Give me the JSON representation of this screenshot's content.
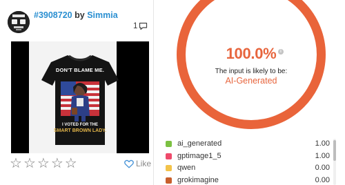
{
  "post": {
    "id_label": "#3908720",
    "by_label": "by",
    "author": "Simmia",
    "comment_count": "1"
  },
  "tshirt": {
    "top_line": "DON'T BLAME ME.",
    "bottom_line1": "I VOTED FOR THE",
    "bottom_line2": "SMART BROWN LADY."
  },
  "rating": {
    "stars": [
      "☆",
      "☆",
      "☆",
      "☆",
      "☆"
    ],
    "like_label": "Like"
  },
  "result": {
    "percent": "100.0%",
    "info_glyph": "i",
    "likely_text": "The input is likely to be:",
    "verdict": "AI-Generated",
    "accent_color": "#e7653d"
  },
  "models": [
    {
      "name": "ai_generated",
      "score": "1.00",
      "color": "#7cc142"
    },
    {
      "name": "gptimage1_5",
      "score": "1.00",
      "color": "#ef4a6b"
    },
    {
      "name": "qwen",
      "score": "0.00",
      "color": "#f3c34a"
    },
    {
      "name": "grokimagine",
      "score": "0.00",
      "color": "#c85f2c"
    }
  ],
  "icons": {
    "comment": "speech-bubble-icon",
    "like": "heart-icon",
    "info": "info-icon"
  }
}
